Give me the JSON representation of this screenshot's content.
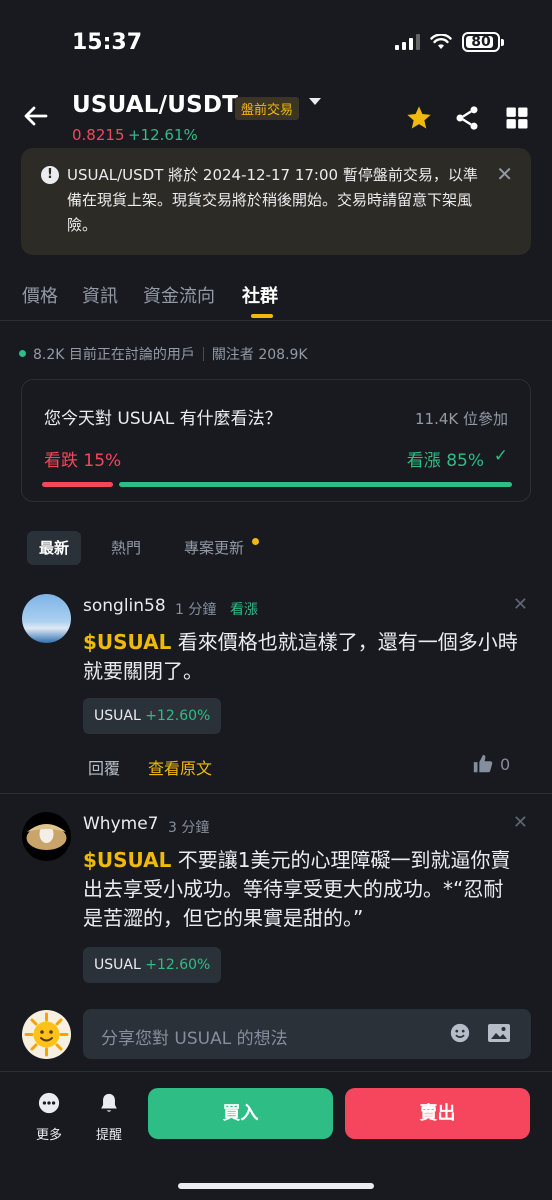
{
  "status_bar": {
    "time": "15:37",
    "battery": "80"
  },
  "header": {
    "pair": "USUAL/USDT",
    "badge": "盤前交易",
    "price": "0.8215",
    "change": "+12.61%"
  },
  "notice": {
    "text": "USUAL/USDT 將於 2024-12-17 17:00 暫停盤前交易，以準備在現貨上架。現貨交易將於稍後開始。交易時請留意下架風險。"
  },
  "tabs": [
    "價格",
    "資訊",
    "資金流向",
    "社群"
  ],
  "stats": {
    "online": "8.2K 目前正在討論的用戶",
    "followers": "關注者 208.9K"
  },
  "poll": {
    "question": "您今天對 USUAL 有什麼看法？",
    "participants": "11.4K 位參加",
    "bearish_label": "看跌 15%",
    "bullish_label": "看漲 85%",
    "bearish_pct": 15,
    "bullish_pct": 85
  },
  "filters": [
    "最新",
    "熱門",
    "專案更新"
  ],
  "posts": [
    {
      "username": "songlin58",
      "ago": "1 分鐘",
      "sentiment": "看漲",
      "ticker": "$USUAL",
      "text": " 看來價格也就這樣了，還有一個多小時就要關閉了。",
      "tag_symbol": "USUAL",
      "tag_change": "+12.60%",
      "reply": "回覆",
      "view_original": "查看原文",
      "likes": "0"
    },
    {
      "username": "Whyme7",
      "ago": "3 分鐘",
      "ticker": "$USUAL",
      "text": " 不要讓1美元的心理障礙一到就逼你賣出去享受小成功。等待享受更大的成功。*“忍耐是苦澀的，但它的果實是甜的。”",
      "tag_symbol": "USUAL",
      "tag_change": "+12.60%"
    }
  ],
  "composer": {
    "placeholder": "分享您對 USUAL 的想法"
  },
  "bottom_bar": {
    "more": "更多",
    "alert": "提醒",
    "buy": "買入",
    "sell": "賣出"
  },
  "colors": {
    "up": "#2ebd85",
    "down": "#f6465d",
    "accent": "#f0b90b",
    "background": "#181a20"
  }
}
